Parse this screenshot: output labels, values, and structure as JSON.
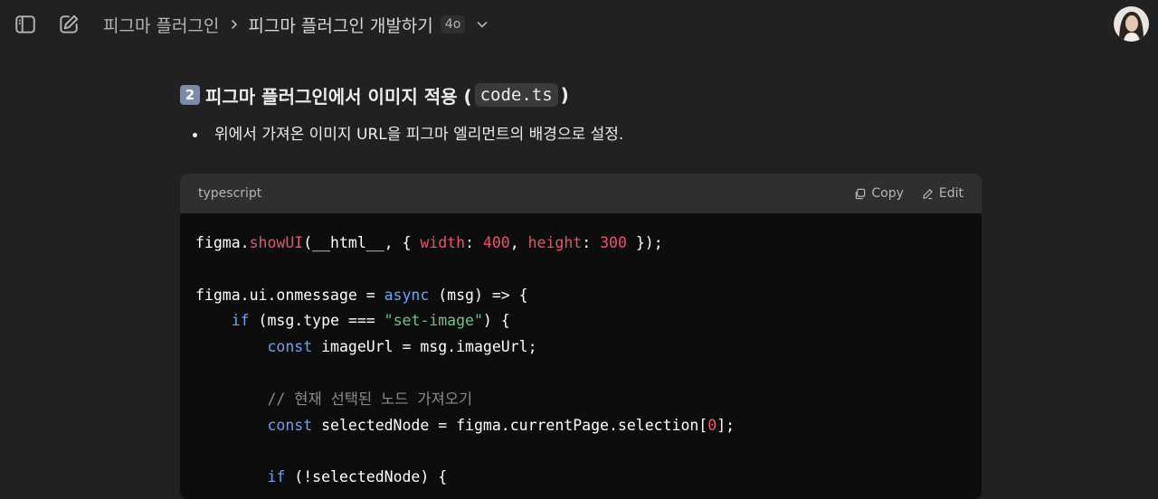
{
  "topbar": {
    "breadcrumb_parent": "피그마 플러그인",
    "breadcrumb_current": "피그마 플러그인 개발하기",
    "model_badge": "4o"
  },
  "section": {
    "number": "2",
    "heading_text": "피그마 플러그인에서 이미지 적용 (",
    "heading_code": "code.ts",
    "heading_close": ")",
    "bullet": "위에서 가져온 이미지 URL을 피그마 엘리먼트의 배경으로 설정."
  },
  "codeblock": {
    "language": "typescript",
    "copy_label": "Copy",
    "edit_label": "Edit",
    "lines": [
      [
        [
          "txt",
          "figma."
        ],
        [
          "fn",
          "showUI"
        ],
        [
          "txt",
          "(__html__, { "
        ],
        [
          "prop",
          "width"
        ],
        [
          "txt",
          ": "
        ],
        [
          "num",
          "400"
        ],
        [
          "txt",
          ", "
        ],
        [
          "prop",
          "height"
        ],
        [
          "txt",
          ": "
        ],
        [
          "num",
          "300"
        ],
        [
          "txt",
          " });"
        ]
      ],
      [],
      [
        [
          "txt",
          "figma.ui.onmessage = "
        ],
        [
          "kw",
          "async"
        ],
        [
          "txt",
          " (msg) => {"
        ]
      ],
      [
        [
          "txt",
          "    "
        ],
        [
          "kw",
          "if"
        ],
        [
          "txt",
          " (msg.type === "
        ],
        [
          "str",
          "\"set-image\""
        ],
        [
          "txt",
          ") {"
        ]
      ],
      [
        [
          "txt",
          "        "
        ],
        [
          "kw",
          "const"
        ],
        [
          "txt",
          " imageUrl = msg.imageUrl;"
        ]
      ],
      [],
      [
        [
          "txt",
          "        "
        ],
        [
          "cmt",
          "// 현재 선택된 노드 가져오기"
        ]
      ],
      [
        [
          "txt",
          "        "
        ],
        [
          "kw",
          "const"
        ],
        [
          "txt",
          " selectedNode = figma.currentPage.selection["
        ],
        [
          "num",
          "0"
        ],
        [
          "txt",
          "];"
        ]
      ],
      [],
      [
        [
          "txt",
          "        "
        ],
        [
          "kw",
          "if"
        ],
        [
          "txt",
          " (!selectedNode) {"
        ]
      ]
    ]
  }
}
